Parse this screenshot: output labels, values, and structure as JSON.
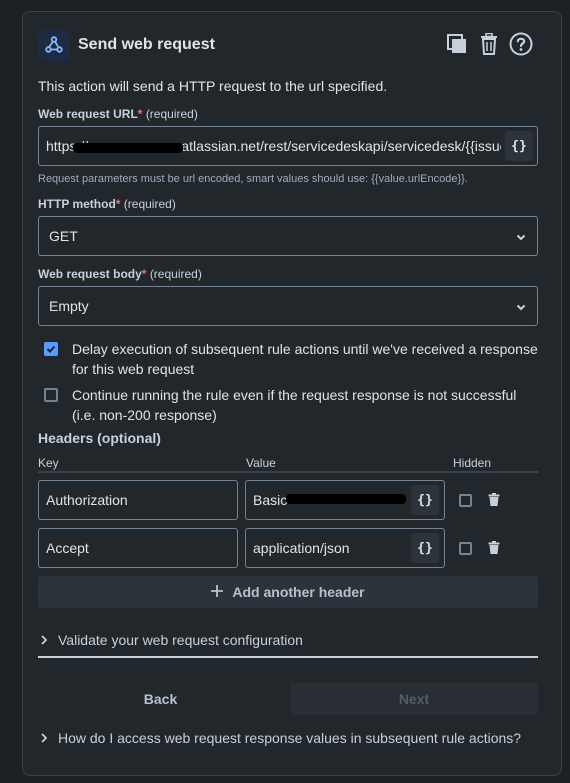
{
  "header": {
    "title": "Send web request",
    "description": "This action will send a HTTP request to the url specified.",
    "icons": [
      "webhook-icon",
      "copy-icon",
      "trash-icon",
      "question-circle-icon"
    ]
  },
  "url": {
    "label": "Web request URL",
    "required_mark": "*",
    "required_hint": "(required)",
    "value": "https://                       .atlassian.net/rest/servicedeskapi/servicedesk/{{issue.I",
    "braces": "{}",
    "helper": "Request parameters must be url encoded, smart values should use: {{value.urlEncode}}."
  },
  "method": {
    "label": "HTTP method",
    "required_mark": "*",
    "required_hint": "(required)",
    "value": "GET"
  },
  "body": {
    "label": "Web request body",
    "required_mark": "*",
    "required_hint": "(required)",
    "value": "Empty"
  },
  "options": {
    "delay": "Delay execution of subsequent rule actions until we've received a response for this web request",
    "delay_checked": true,
    "continue": "Continue running the rule even if the request response is not successful (i.e. non-200 response)",
    "continue_checked": false
  },
  "headers": {
    "title": "Headers (optional)",
    "columns": [
      "Key",
      "Value",
      "Hidden"
    ],
    "rows": [
      {
        "key": "Authorization",
        "value": "Basic",
        "hidden": false
      },
      {
        "key": "Accept",
        "value": "application/json",
        "hidden": false
      }
    ],
    "add_label": "Add another header"
  },
  "footer": {
    "validate": "Validate your web request configuration",
    "back": "Back",
    "next": "Next",
    "help": "How do I access web request response values in subsequent rule actions?"
  },
  "colors": {
    "background": "#22272b",
    "accent": "#579dff",
    "required": "#f87168"
  }
}
